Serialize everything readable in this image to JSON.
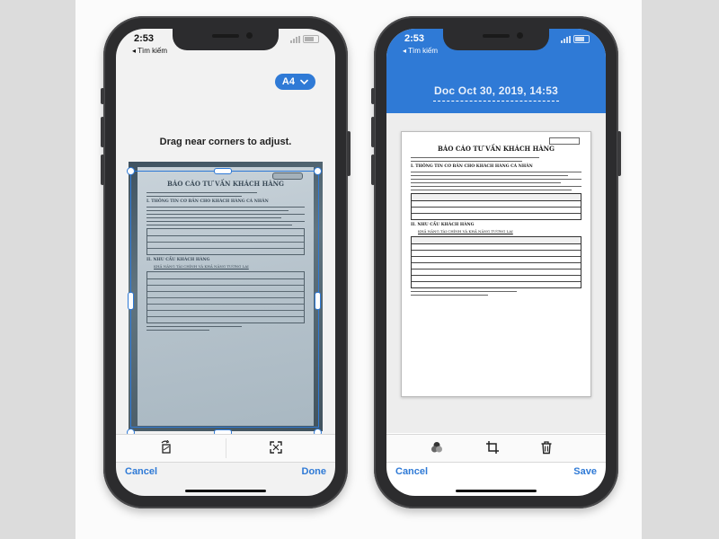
{
  "left_phone": {
    "status_time": "2:53",
    "back_label": "◂ Tìm kiếm",
    "page_size_label": "A4",
    "chevron_icon": "chevron-down-icon",
    "instruction": "Drag near corners to adjust.",
    "toolbar_icons": [
      "rotate-icon",
      "expand-corners-icon"
    ],
    "cancel_label": "Cancel",
    "done_label": "Done"
  },
  "right_phone": {
    "status_time": "2:53",
    "back_label": "◂ Tìm kiếm",
    "doc_title": "Doc Oct 30, 2019, 14:53",
    "toolbar_icons": [
      "color-filter-icon",
      "crop-icon",
      "trash-icon"
    ],
    "cancel_label": "Cancel",
    "save_label": "Save"
  },
  "document": {
    "title": "BÁO CÁO TƯ VẤN KHÁCH HÀNG",
    "section1": "I.   THÔNG TIN CƠ BẢN CHO KHÁCH HÀNG CÁ NHÂN",
    "section2": "II.  NHU CẦU KHÁCH HÀNG",
    "section2_sub": "KHẢ NĂNG TÀI CHÍNH VÀ KHẢ NĂNG TƯƠNG LAI"
  },
  "colors": {
    "accent": "#2f7ad6",
    "phone_body": "#2c2c2e"
  }
}
